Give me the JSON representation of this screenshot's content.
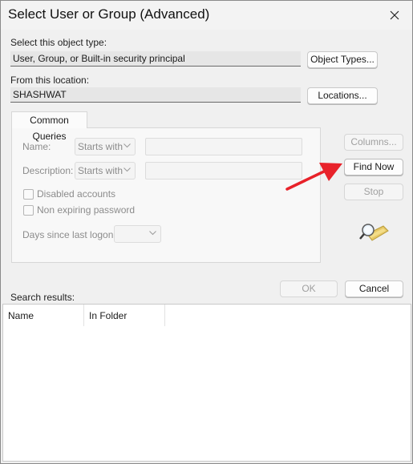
{
  "window": {
    "title": "Select User or Group (Advanced)"
  },
  "object_type": {
    "label": "Select this object type:",
    "value": "User, Group, or Built-in security principal",
    "button": "Object Types..."
  },
  "location": {
    "label": "From this location:",
    "value": "SHASHWAT",
    "button": "Locations..."
  },
  "common_queries": {
    "tab_label": "Common Queries",
    "name_label": "Name:",
    "name_mode": "Starts with",
    "description_label": "Description:",
    "description_mode": "Starts with",
    "disabled_accounts_label": "Disabled accounts",
    "non_expiring_label": "Non expiring password",
    "days_label": "Days since last logon:"
  },
  "side_buttons": {
    "columns": "Columns...",
    "find_now": "Find Now",
    "stop": "Stop"
  },
  "dialog_buttons": {
    "ok": "OK",
    "cancel": "Cancel"
  },
  "results": {
    "label": "Search results:",
    "columns": [
      "Name",
      "In Folder"
    ]
  },
  "colors": {
    "annotation_arrow": "#e8222a"
  },
  "icons": {
    "close": "close-icon",
    "search": "search-magnifier-icon"
  }
}
